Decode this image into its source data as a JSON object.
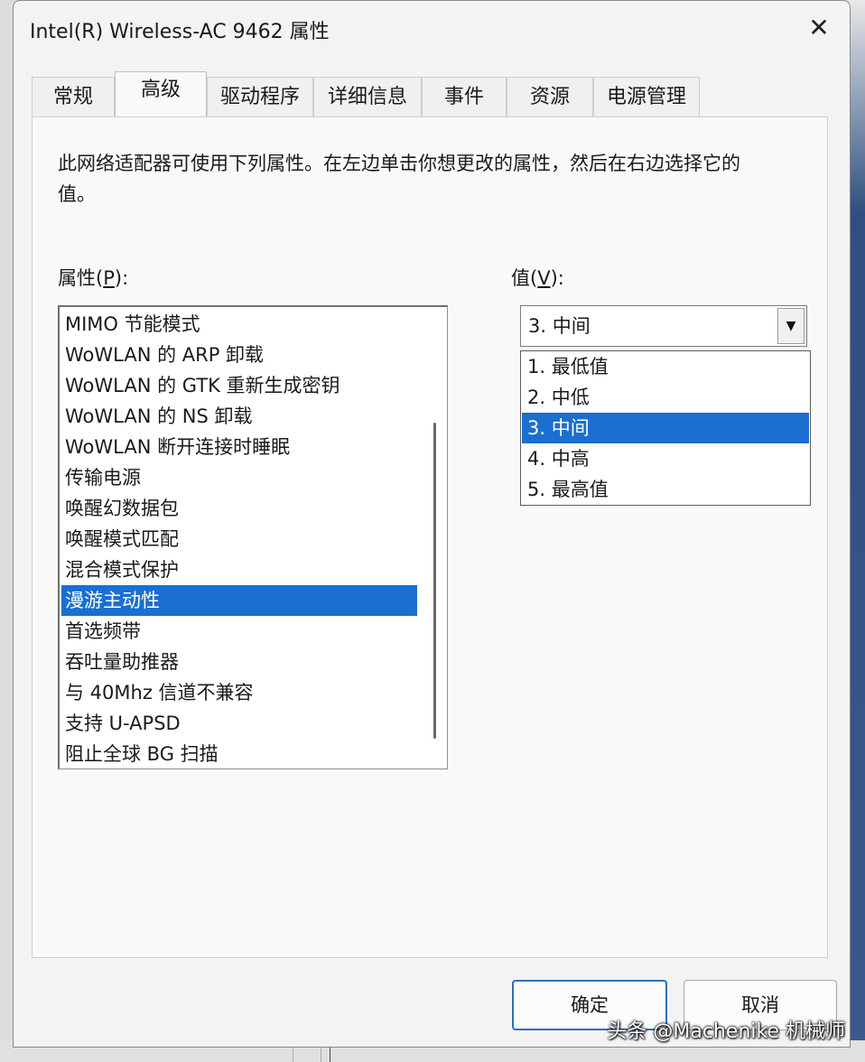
{
  "window": {
    "title": "Intel(R) Wireless-AC 9462 属性",
    "close_glyph": "✕"
  },
  "tabs": [
    {
      "label": "常规"
    },
    {
      "label": "高级",
      "active": true
    },
    {
      "label": "驱动程序"
    },
    {
      "label": "详细信息"
    },
    {
      "label": "事件"
    },
    {
      "label": "资源"
    },
    {
      "label": "电源管理"
    }
  ],
  "advanced": {
    "description": "此网络适配器可使用下列属性。在左边单击你想更改的属性，然后在右边选择它的值。",
    "property_label_prefix": "属性(",
    "property_label_key": "P",
    "property_label_suffix": "):",
    "value_label_prefix": "值(",
    "value_label_key": "V",
    "value_label_suffix": "):",
    "properties": [
      "MIMO 节能模式",
      "WoWLAN 的 ARP 卸载",
      "WoWLAN 的 GTK 重新生成密钥",
      "WoWLAN 的 NS 卸载",
      "WoWLAN 断开连接时睡眠",
      "传输电源",
      "唤醒幻数据包",
      "唤醒模式匹配",
      "混合模式保护",
      "漫游主动性",
      "首选频带",
      "吞吐量助推器",
      "与 40Mhz 信道不兼容",
      "支持 U-APSD",
      "阻止全球 BG 扫描"
    ],
    "selected_property": "漫游主动性",
    "combo_value": "3. 中间",
    "combo_arrow": "▼",
    "value_options": [
      "1. 最低值",
      "2. 中低",
      "3. 中间",
      "4. 中高",
      "5. 最高值"
    ],
    "selected_value": "3. 中间"
  },
  "buttons": {
    "ok": "确定",
    "cancel": "取消"
  },
  "watermark": "头条 @Machenike 机械师",
  "colors": {
    "selection": "#1a6fd1",
    "dialog_bg": "#f3f3f3",
    "default_button_border": "#2f6fbf"
  }
}
